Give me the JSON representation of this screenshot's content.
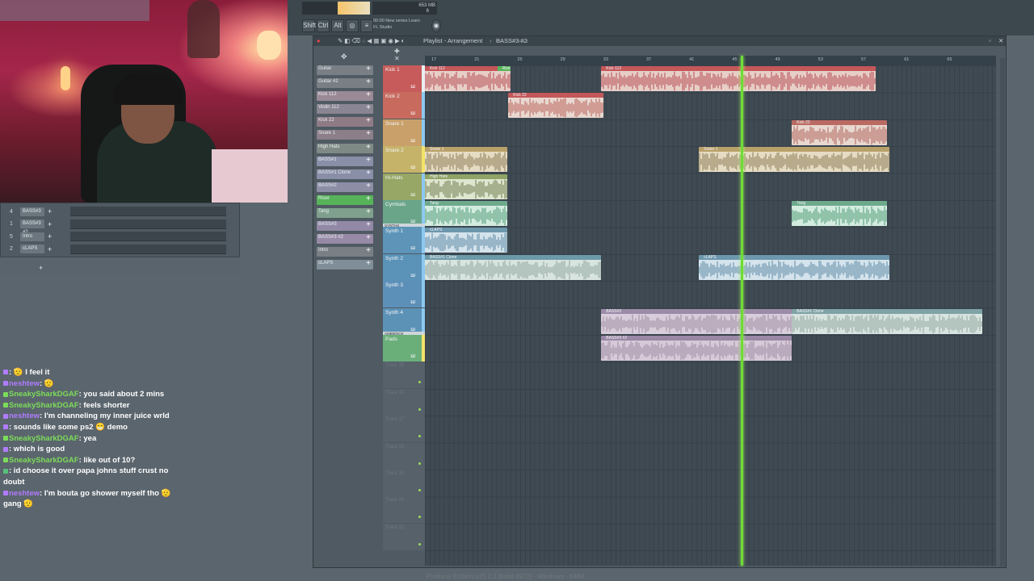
{
  "fl_top": {
    "cpu_text": "653 MB",
    "voices": "6",
    "hint_line1": "00:00 New series Learn",
    "hint_line2": "FL Studio",
    "keys": [
      "Shift",
      "Ctrl",
      "Alt"
    ]
  },
  "playlist": {
    "title": "Playlist - Arrangement",
    "breadcrumb": "BASS#3 #2",
    "status": "Producer Edition v25.2.3 [build 4972] - Windows - 64Bit"
  },
  "picker": [
    {
      "label": "Guitar",
      "color": "#7a7f86"
    },
    {
      "label": "Guitar #2",
      "color": "#7a7f86"
    },
    {
      "label": "Kick 112",
      "color": "#9a8a96"
    },
    {
      "label": "Violin 112",
      "color": "#8a8592"
    },
    {
      "label": "Kick 22",
      "color": "#8e7b86"
    },
    {
      "label": "Snare 1",
      "color": "#8c7f8a"
    },
    {
      "label": "High Hats",
      "color": "#7f8a86"
    },
    {
      "label": "BASS#1",
      "color": "#8a8fa8"
    },
    {
      "label": "BASS#1 Clone",
      "color": "#8a8fa8"
    },
    {
      "label": "BASS#2",
      "color": "#8d8ea6"
    },
    {
      "label": "Riser",
      "color": "#57b35a"
    },
    {
      "label": "Tang",
      "color": "#7fa08c"
    },
    {
      "label": "BASS#3",
      "color": "#9289a6"
    },
    {
      "label": "BASS#3 #2",
      "color": "#978aa6"
    },
    {
      "label": "Intro",
      "color": "#7a7f86"
    },
    {
      "label": "cLAPS",
      "color": "#7f8e98"
    }
  ],
  "tracks": [
    {
      "label": "Kick 1",
      "color": "#c75a5a",
      "group": ""
    },
    {
      "label": "Kick 2",
      "color": "#c86a5e",
      "group": ""
    },
    {
      "label": "Snare 1",
      "color": "#c9a06a",
      "group": ""
    },
    {
      "label": "Snare 2",
      "color": "#c6b36a",
      "group": ""
    },
    {
      "label": "Hi-Hats",
      "color": "#97a765",
      "group": ""
    },
    {
      "label": "Cymbals",
      "color": "#6aa58a",
      "group": ""
    },
    {
      "label": "Synth 1",
      "color": "#5d94b8",
      "group": "SYNTHS"
    },
    {
      "label": "Synth 2",
      "color": "#5a92b8",
      "group": ""
    },
    {
      "label": "Synth 3",
      "color": "#5d90b8",
      "group": ""
    },
    {
      "label": "Synth 4",
      "color": "#5d92b7",
      "group": ""
    },
    {
      "label": "Pads",
      "color": "#6aaf7a",
      "group": "AMBIENCE"
    }
  ],
  "empty_tracks": [
    "Track 15",
    "Track 16",
    "Track 17",
    "Track 18",
    "Track 19",
    "Track 20",
    "Track 21"
  ],
  "ruler_ticks": [
    "17",
    "21",
    "25",
    "29",
    "33",
    "37",
    "41",
    "45",
    "49",
    "53",
    "57",
    "61",
    "65"
  ],
  "clips": [
    {
      "track": 0,
      "start": 0,
      "len": 17.3,
      "name": "Kick 112",
      "head": "#c4575a",
      "body": "#e7cfc8",
      "wave": "#b74a50"
    },
    {
      "track": 0,
      "start": 15.2,
      "len": 2.8,
      "name": "Riser",
      "head": "#59b65c",
      "body": "#e7cfc8",
      "wave": "#b74a50"
    },
    {
      "track": 0,
      "start": 37.0,
      "len": 57.5,
      "name": "Kick 112",
      "head": "#c4575a",
      "body": "#e7cfc8",
      "wave": "#b74a50"
    },
    {
      "track": 1,
      "start": 17.5,
      "len": 20,
      "name": "Kick 22",
      "head": "#c4575a",
      "body": "#e8d8d0",
      "wave": "#b85f58"
    },
    {
      "track": 2,
      "start": 77.0,
      "len": 20,
      "name": "Kick 22",
      "head": "#ba6a62",
      "body": "#e8d8d0",
      "wave": "#b0625a"
    },
    {
      "track": 3,
      "start": 0,
      "len": 17.3,
      "name": "Snare 1",
      "head": "#b8a069",
      "body": "#e6dcc4",
      "wave": "#8a7a55"
    },
    {
      "track": 3,
      "start": 57.5,
      "len": 40,
      "name": "Snare 1",
      "head": "#b8a069",
      "body": "#e6dcc4",
      "wave": "#8a7a55"
    },
    {
      "track": 4,
      "start": 0,
      "len": 17.3,
      "name": "High Hats",
      "head": "#8fa466",
      "body": "#dfe6cf",
      "wave": "#6d7a4c"
    },
    {
      "track": 5,
      "start": 0,
      "len": 17.3,
      "name": "Tang",
      "head": "#6ea98c",
      "body": "#d4ece0",
      "wave": "#4e9a76"
    },
    {
      "track": 5,
      "start": 77.0,
      "len": 20,
      "name": "Tang",
      "head": "#6ea98c",
      "body": "#d4ece0",
      "wave": "#4e9a76"
    },
    {
      "track": 6,
      "start": 0,
      "len": 17.3,
      "name": "cLAPS",
      "head": "#6d97ad",
      "body": "#d4e3ec",
      "wave": "#5d89a4"
    },
    {
      "track": 7,
      "start": 0,
      "len": 37.0,
      "name": "BASS#1 Clone",
      "head": "#6d9aa8",
      "body": "#d8e4df",
      "wave": "#8fa59d"
    },
    {
      "track": 7,
      "start": 57.5,
      "len": 40,
      "name": "cLAPS",
      "head": "#6d97ad",
      "body": "#d4e3ec",
      "wave": "#5d89a4"
    },
    {
      "track": 9,
      "start": 37.0,
      "len": 40,
      "name": "BASS#3",
      "head": "#9c8ba8",
      "body": "#d8cdda",
      "wave": "#9e8aa2"
    },
    {
      "track": 9,
      "start": 77.0,
      "len": 40,
      "name": "BASS#1 Clone",
      "head": "#7fa2a6",
      "body": "#d8e4df",
      "wave": "#8fa59d"
    },
    {
      "track": 10,
      "start": 37.0,
      "len": 40,
      "name": "BASS#3 #2",
      "head": "#9a88a6",
      "body": "#d6c9d8",
      "wave": "#9e8aa2"
    }
  ],
  "playhead_step": 66.2,
  "small_rack": [
    {
      "num": "4",
      "name": "BASS#3"
    },
    {
      "num": "1",
      "name": "BASS#3 #2"
    },
    {
      "num": "5",
      "name": "Intro"
    },
    {
      "num": "2",
      "name": "cLAPS"
    }
  ],
  "chat": [
    {
      "user": "",
      "user_color": "#b07cff",
      "text": ": 🫡 I feel it"
    },
    {
      "user": "neshtew",
      "user_color": "#b07cff",
      "text": ": 🫡"
    },
    {
      "user": "SneakySharkDGAF",
      "user_color": "#7cdc5a",
      "text": ": you said about 2 mins"
    },
    {
      "user": "SneakySharkDGAF",
      "user_color": "#7cdc5a",
      "text": ": feels shorter"
    },
    {
      "user": "neshtew",
      "user_color": "#b07cff",
      "text": ": I'm channeling my inner juice wrld"
    },
    {
      "user": "",
      "user_color": "#b07cff",
      "text": ": sounds like some ps2 😁 demo"
    },
    {
      "user": "SneakySharkDGAF",
      "user_color": "#7cdc5a",
      "text": ": yea"
    },
    {
      "user": "",
      "user_color": "#b07cff",
      "text": ": which is good"
    },
    {
      "user": "SneakySharkDGAF",
      "user_color": "#7cdc5a",
      "text": ": like out of 10?"
    },
    {
      "user": "",
      "user_color": "#58c07a",
      "text": ": id choose it over papa johns stuff crust no doubt"
    },
    {
      "user": "neshtew",
      "user_color": "#b07cff",
      "text": ": I'm bouta go shower myself tho 🫡 gang 🫡"
    }
  ]
}
